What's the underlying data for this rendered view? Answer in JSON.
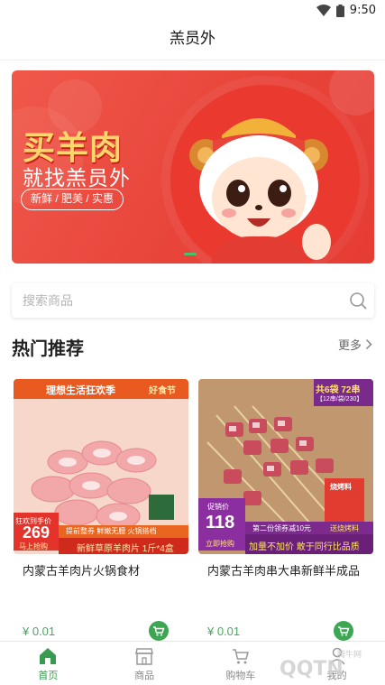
{
  "status_bar": {
    "time": "9:50"
  },
  "app_bar": {
    "title": "羔员外"
  },
  "banner": {
    "headline": "买羊肉",
    "subline": "就找羔员外",
    "tags": "新鲜 / 肥美 / 实惠"
  },
  "search": {
    "placeholder": "搜索商品"
  },
  "section": {
    "title": "热门推荐",
    "more_label": "更多"
  },
  "products": [
    {
      "name": "内蒙古羊肉片火锅食材",
      "price": "¥ 0.01",
      "image": {
        "top_banner": "理想生活狂欢季",
        "brand": "好食节",
        "badge_top": "狂欢到手价",
        "badge_price": "269",
        "badge_bottom": "马上抢购",
        "strip_top": "提前整券 鲜嫩无膻 火锅搭档",
        "strip_bottom": "新鲜草原羊肉片 1斤*4盒"
      }
    },
    {
      "name": "内蒙古羊肉串大串新鲜半成品",
      "price": "¥ 0.01",
      "image": {
        "corner_top": "共6袋 72串",
        "corner_bottom": "【12串/袋/230】",
        "badge_top": "促销价",
        "badge_price": "118",
        "badge_bottom": "立即抢购",
        "strip_top": "第二份领券减10元",
        "strip_top_right": "送烧烤料",
        "strip_bottom": "加量不加价 敢于同行比品质",
        "seasoning": "烧烤料"
      }
    }
  ],
  "bottom_nav": {
    "items": [
      {
        "label": "首页",
        "icon": "home-icon",
        "active": true
      },
      {
        "label": "商品",
        "icon": "shop-icon",
        "active": false
      },
      {
        "label": "购物车",
        "icon": "cart-icon",
        "active": false
      },
      {
        "label": "我的",
        "icon": "user-icon",
        "active": false
      }
    ]
  },
  "watermark": {
    "text": "QQTN",
    "sub": "腾牛网"
  },
  "colors": {
    "accent": "#3ca653",
    "banner_red": "#e8443a",
    "price_green": "#4aa85e"
  }
}
